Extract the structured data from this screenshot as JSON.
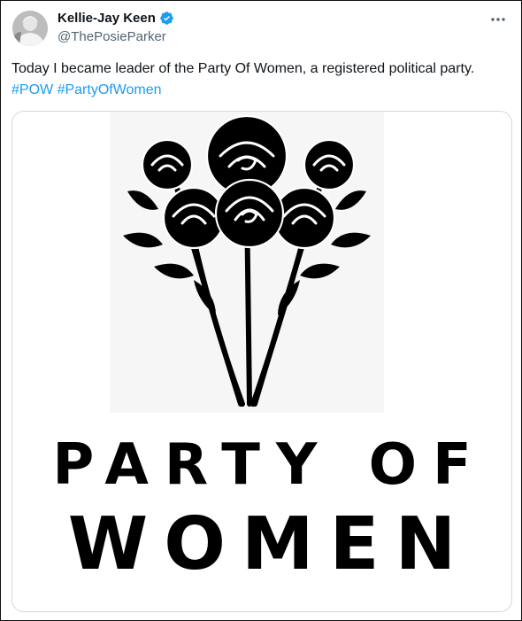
{
  "tweet": {
    "author": {
      "display_name": "Kellie-Jay Keen",
      "handle": "@ThePosieParker",
      "verified_icon": "verified-badge-icon"
    },
    "text": "Today I became leader of the Party Of Women, a registered political party.",
    "hashtags": [
      "#POW",
      "#PartyOfWomen"
    ],
    "media": {
      "logo_line_1": "PARTY OF",
      "logo_line_2": "WOMEN",
      "icon": "rose-bouquet-icon"
    },
    "menu_icon": "more-options-icon"
  },
  "colors": {
    "link": "#1d9bf0",
    "verified": "#1d9bf0",
    "text": "#0f1419",
    "secondary": "#536471"
  }
}
